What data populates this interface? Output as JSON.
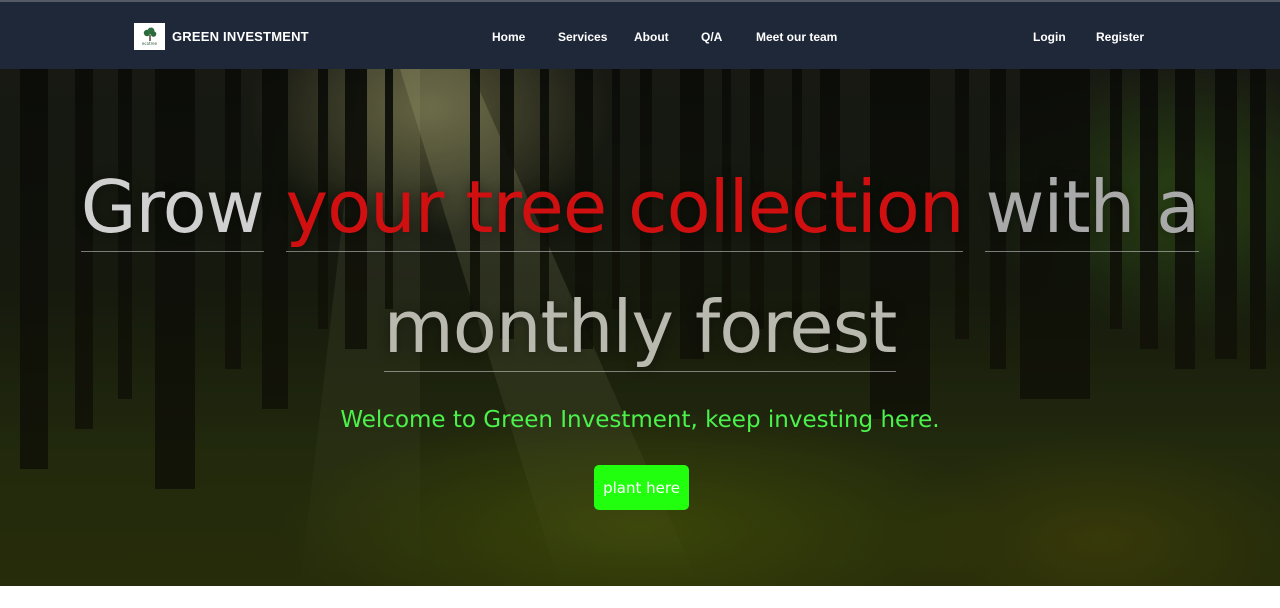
{
  "brand": {
    "name": "GREEN INVESTMENT",
    "logo_text": "ecotree",
    "logo_icon": "tree-icon"
  },
  "nav": {
    "items": [
      "Home",
      "Services",
      "About",
      "Q/A",
      "Meet our team"
    ],
    "login": "Login",
    "register": "Register"
  },
  "hero": {
    "headline_part1": "Grow",
    "headline_part2": "your tree collection",
    "headline_part3": "with a",
    "headline_line2": "monthly forest",
    "subtitle": "Welcome to Green Investment, keep investing here.",
    "cta": "plant here"
  },
  "colors": {
    "navbar_bg": "#1f2838",
    "accent_red": "#d01010",
    "accent_green": "#4cf24c",
    "cta_bg": "#22ff0e"
  }
}
